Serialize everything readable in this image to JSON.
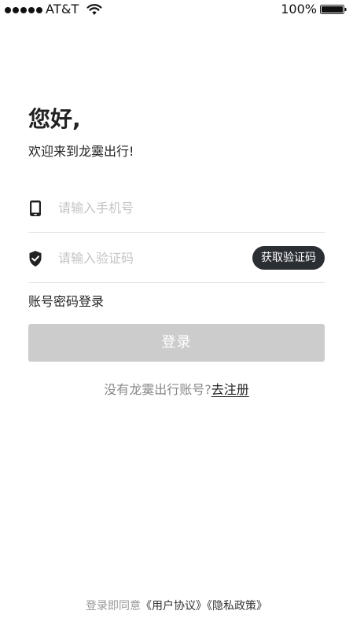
{
  "status_bar": {
    "carrier": "AT&T",
    "battery_percent": "100%",
    "signal_bars": 5
  },
  "greeting": {
    "title": "您好,",
    "subtitle": "欢迎来到龙霙出行!"
  },
  "phone_field": {
    "icon": "phone-icon",
    "placeholder": "请输入手机号",
    "value": ""
  },
  "code_field": {
    "icon": "shield-check-icon",
    "placeholder": "请输入验证码",
    "value": "",
    "get_code_label": "获取验证码"
  },
  "password_login_label": "账号密码登录",
  "login_button_label": "登录",
  "register": {
    "prompt": "没有龙霙出行账号?",
    "link": "去注册"
  },
  "agreement": {
    "prefix": "登录即同意",
    "user_agreement": "《用户协议》",
    "privacy_policy": "《隐私政策》"
  },
  "colors": {
    "accent_dark": "#2b2e33",
    "login_button_disabled": "#cccccc",
    "divider": "#e2e2e2",
    "placeholder": "#c4c4c4"
  }
}
